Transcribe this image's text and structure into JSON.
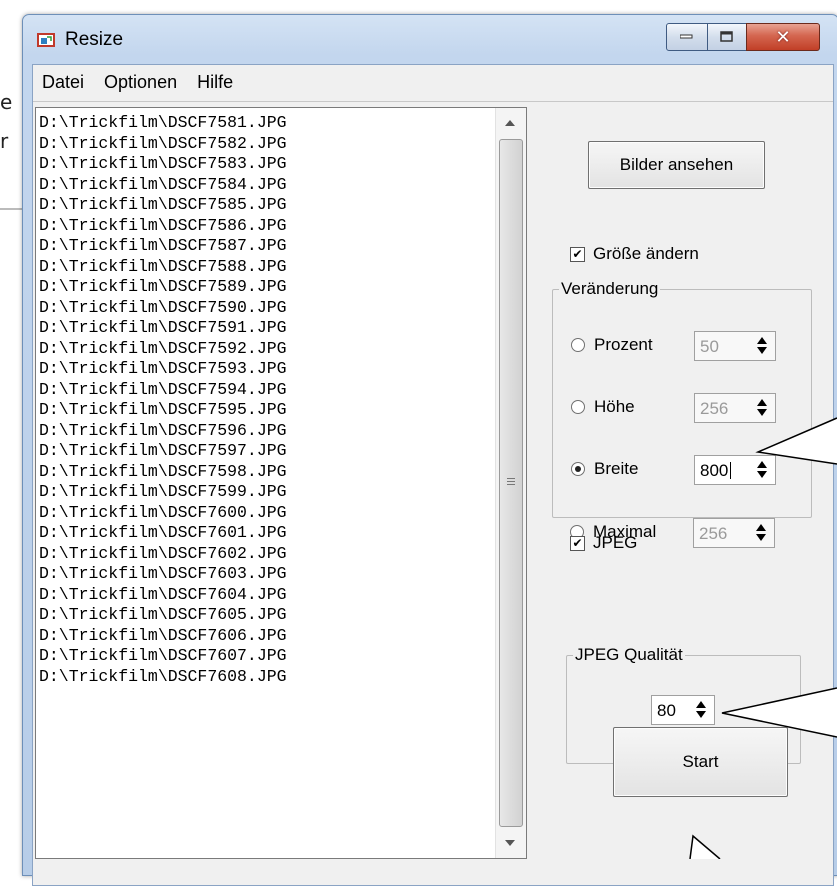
{
  "window": {
    "title": "Resize"
  },
  "menu": [
    "Datei",
    "Optionen",
    "Hilfe"
  ],
  "file_list": [
    "D:\\Trickfilm\\DSCF7581.JPG",
    "D:\\Trickfilm\\DSCF7582.JPG",
    "D:\\Trickfilm\\DSCF7583.JPG",
    "D:\\Trickfilm\\DSCF7584.JPG",
    "D:\\Trickfilm\\DSCF7585.JPG",
    "D:\\Trickfilm\\DSCF7586.JPG",
    "D:\\Trickfilm\\DSCF7587.JPG",
    "D:\\Trickfilm\\DSCF7588.JPG",
    "D:\\Trickfilm\\DSCF7589.JPG",
    "D:\\Trickfilm\\DSCF7590.JPG",
    "D:\\Trickfilm\\DSCF7591.JPG",
    "D:\\Trickfilm\\DSCF7592.JPG",
    "D:\\Trickfilm\\DSCF7593.JPG",
    "D:\\Trickfilm\\DSCF7594.JPG",
    "D:\\Trickfilm\\DSCF7595.JPG",
    "D:\\Trickfilm\\DSCF7596.JPG",
    "D:\\Trickfilm\\DSCF7597.JPG",
    "D:\\Trickfilm\\DSCF7598.JPG",
    "D:\\Trickfilm\\DSCF7599.JPG",
    "D:\\Trickfilm\\DSCF7600.JPG",
    "D:\\Trickfilm\\DSCF7601.JPG",
    "D:\\Trickfilm\\DSCF7602.JPG",
    "D:\\Trickfilm\\DSCF7603.JPG",
    "D:\\Trickfilm\\DSCF7604.JPG",
    "D:\\Trickfilm\\DSCF7605.JPG",
    "D:\\Trickfilm\\DSCF7606.JPG",
    "D:\\Trickfilm\\DSCF7607.JPG",
    "D:\\Trickfilm\\DSCF7608.JPG"
  ],
  "buttons": {
    "view_images": "Bilder ansehen",
    "start": "Start"
  },
  "resize": {
    "enabled_label": "Größe ändern",
    "enabled": true,
    "group_label": "Veränderung",
    "options": [
      {
        "label": "Prozent",
        "value": "50",
        "selected": false
      },
      {
        "label": "Höhe",
        "value": "256",
        "selected": false
      },
      {
        "label": "Breite",
        "value": "800",
        "selected": true
      },
      {
        "label": "Maximal",
        "value": "256",
        "selected": false
      }
    ]
  },
  "jpeg": {
    "enabled_label": "JPEG",
    "enabled": true,
    "group_label": "JPEG Qualität",
    "quality": "80"
  },
  "colors": {
    "window_frame": "#c3d6ee",
    "close_button": "#c13f27",
    "client_bg": "#f0f0f0"
  }
}
